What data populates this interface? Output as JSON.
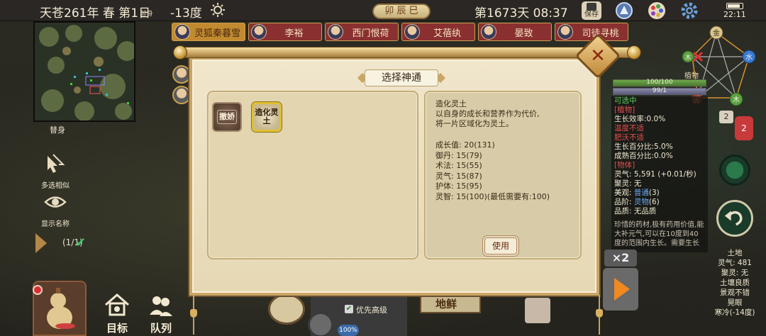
{
  "topbar": {
    "date": "天苍261年 春 第1日",
    "date_sub": "替身",
    "temperature": "-13度",
    "year_badge": "卯 辰 巳",
    "day_time": "第1673天 08:37",
    "save_label": "保存",
    "clock": "22:11"
  },
  "left": {
    "minimap_label": "替身",
    "tool_similar": "多选相似",
    "tool_names": "显示名称",
    "page_count": "(1/1)",
    "nav_target": "目标",
    "nav_team": "队列"
  },
  "char_tabs": [
    {
      "name": "灵狐秦暮雪",
      "style": "gold"
    },
    {
      "name": "李裕",
      "style": "red"
    },
    {
      "name": "西门恨荷",
      "style": "red"
    },
    {
      "name": "艾蓓纨",
      "style": "red"
    },
    {
      "name": "晏致",
      "style": "red"
    },
    {
      "name": "司徒寻桃",
      "style": "red"
    }
  ],
  "dialog": {
    "title": "选择神通",
    "skills": [
      {
        "name": "撤娇",
        "icon": "undo-scroll-icon",
        "selected": false
      },
      {
        "name": "造化灵土",
        "icon": "create-spirit-soil-icon",
        "selected": true
      }
    ],
    "desc_title": "造化灵土",
    "desc_lines": [
      "以自身的成长和营养作为代价,",
      "将一片区域化为灵土。"
    ],
    "stats": [
      "成长值: 20(131)",
      "御丹: 15(79)",
      "术法: 15(55)",
      "灵气: 15(87)",
      "护体: 15(95)",
      "灵智: 15(100)(最低需要有:100)"
    ],
    "use_label": "使用"
  },
  "right": {
    "wuxing": {
      "top": "金",
      "left": "木",
      "right": "水",
      "bottom_right": "木",
      "bottom_left": "火"
    },
    "plant_label": "植物",
    "hp": "100/100",
    "mp": "99/1",
    "badge_two": "2",
    "badge_chat": "2",
    "info": {
      "selectable": "可选中",
      "category": "[植物]",
      "growth_eff": "生长效率:0.0%",
      "temp_bad": "温度不适",
      "fert_bad": "肥沃不适",
      "growth_pct": "生长百分比:5.0%",
      "mature_pct": "成熟百分比:0.0%",
      "props": "[物体]",
      "lingqi": "灵气: 5,591 (+0.01/秒)",
      "juling": "聚灵: 无",
      "meiguan_prefix": "美观: ",
      "meiguan_val": "普通",
      "meiguan_suffix": "(3)",
      "pinjie_prefix": "品阶: ",
      "pinjie_val": "灵物",
      "pinjie_suffix": "(6)",
      "pinzhi": "品质: 无品质",
      "desc": "珍惜的药材,极有药用价值,能大补元气,可以在10度到40度的范围内生长。需要生长"
    },
    "land": [
      "土地",
      "灵气: 481",
      "聚灵: 无",
      "土壤良质",
      "景观不错",
      "晃眼",
      "寒冷(-14度)"
    ]
  },
  "bottom": {
    "priority": "优先高级",
    "terrain": "地鲜",
    "pct": "100%",
    "speed": "×2"
  },
  "colors": {
    "dialog_bg": "#f0e6cc",
    "frame_gold": "#c9a664",
    "tab_red": "#8a3030",
    "tab_gold": "#c28a30"
  }
}
